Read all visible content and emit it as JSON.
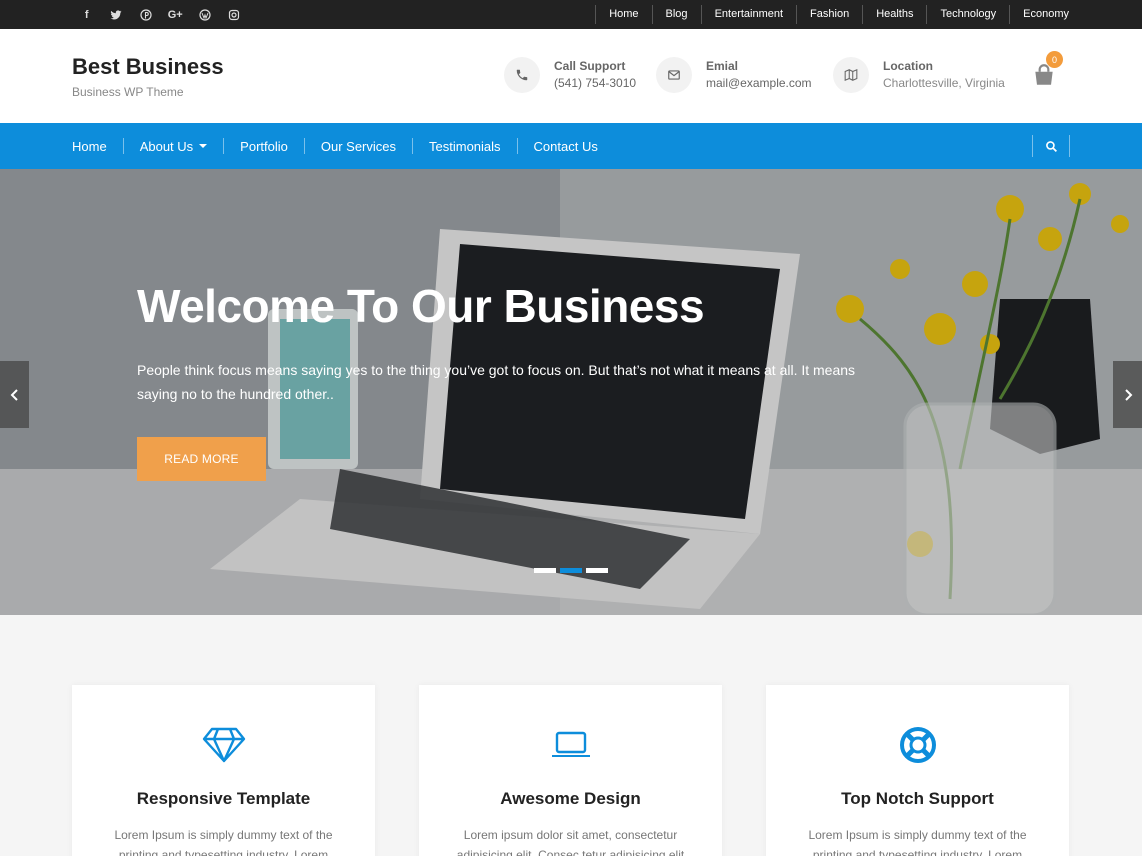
{
  "topbar": {
    "social": [
      "facebook-icon",
      "twitter-icon",
      "pinterest-icon",
      "google-plus-icon",
      "wordpress-icon",
      "instagram-icon"
    ],
    "nav": [
      "Home",
      "Blog",
      "Entertainment",
      "Fashion",
      "Healths",
      "Technology",
      "Economy"
    ]
  },
  "header": {
    "title": "Best Business",
    "subtitle": "Business WP Theme",
    "phone": {
      "label": "Call Support",
      "value": "(541) 754-3010"
    },
    "email": {
      "label": "Emial",
      "value": "mail@example.com"
    },
    "location": {
      "label": "Location",
      "value": "Charlottesville, Virginia"
    },
    "cart_count": "0"
  },
  "mainnav": {
    "items": [
      "Home",
      "About Us",
      "Portfolio",
      "Our Services",
      "Testimonials",
      "Contact Us"
    ]
  },
  "hero": {
    "title": "Welcome To Our Business",
    "text": "People think focus means saying yes to the thing you’ve got to focus on. But that’s not what it means at all. It means saying no to the hundred other..",
    "button": "READ MORE",
    "active_slide": 1,
    "slide_count": 3
  },
  "features": [
    {
      "icon": "diamond-icon",
      "title": "Responsive Template",
      "text": "Lorem Ipsum is simply dummy text of the printing and typesetting industry. Lorem"
    },
    {
      "icon": "laptop-icon",
      "title": "Awesome Design",
      "text": "Lorem ipsum dolor sit amet, consectetur adipisicing elit. Consec tetur adipisicing elit"
    },
    {
      "icon": "lifebuoy-icon",
      "title": "Top Notch Support",
      "text": "Lorem Ipsum is simply dummy text of the printing and typesetting industry. Lorem"
    }
  ],
  "colors": {
    "accent": "#0d8ddb",
    "button": "#f0a04b",
    "topbar": "#222222"
  }
}
